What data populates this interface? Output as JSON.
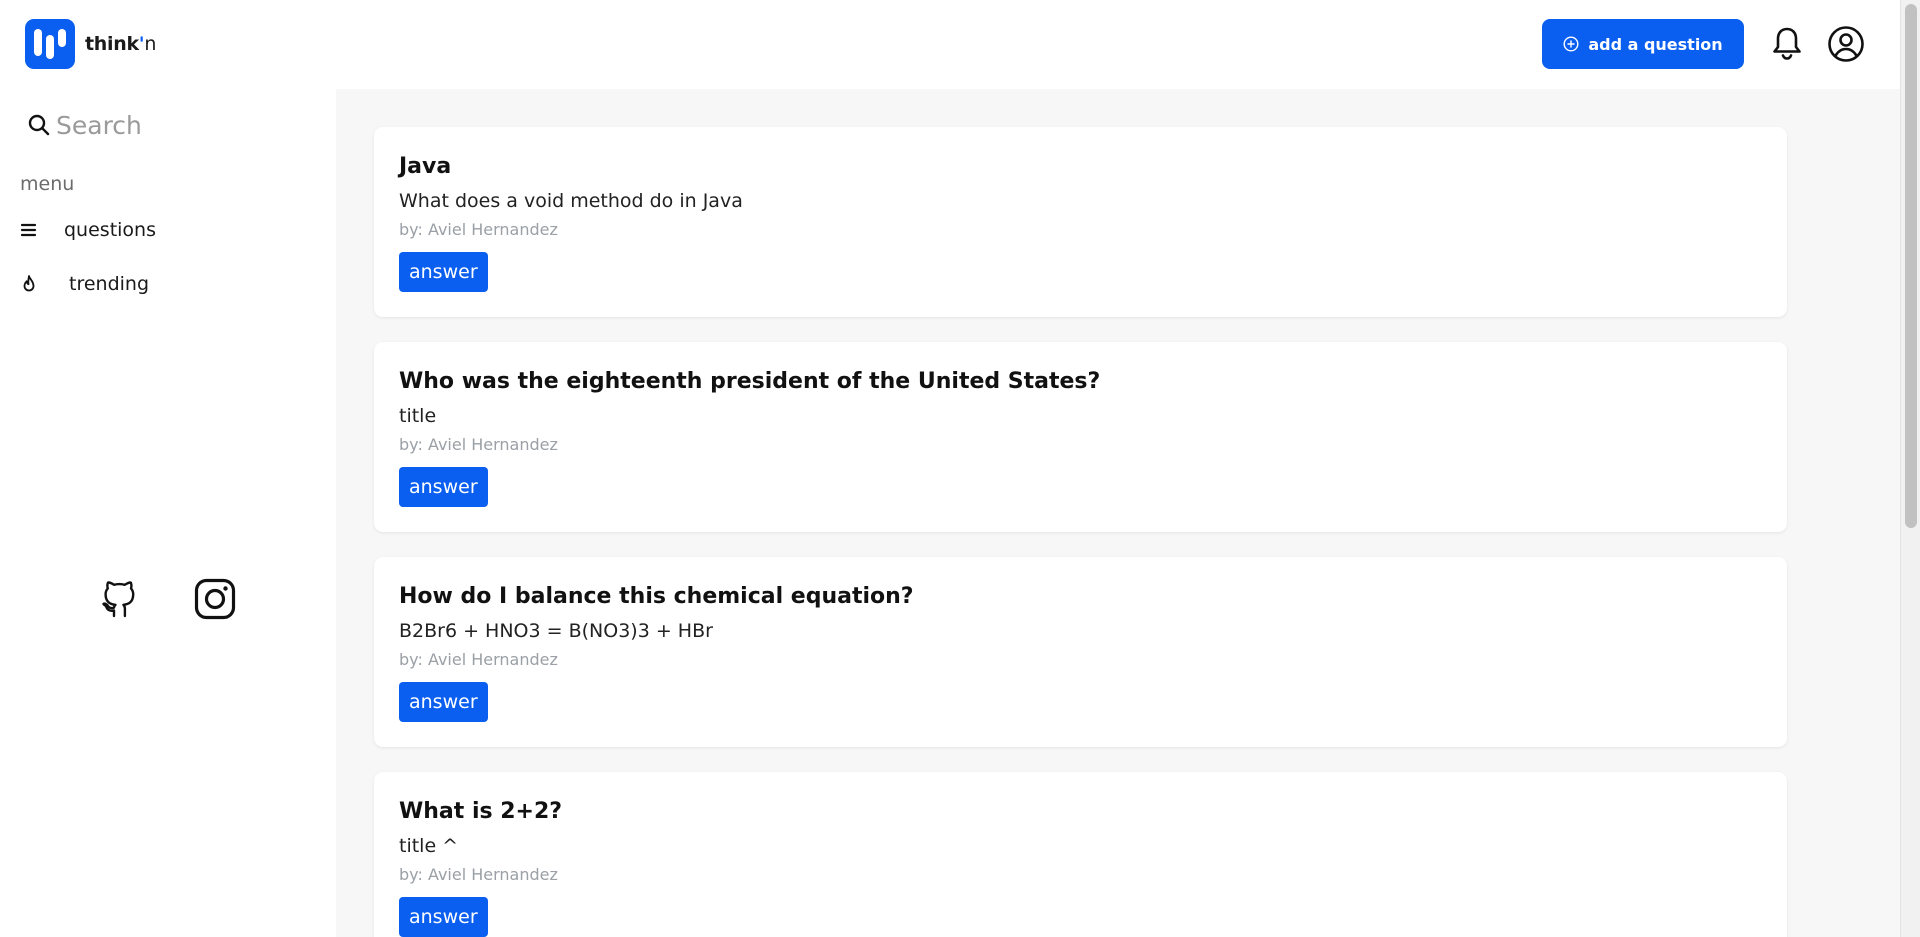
{
  "app": {
    "logo_text_think": "think",
    "logo_text_apos": "'",
    "logo_text_n": "n"
  },
  "header": {
    "add_question_label": "add a question"
  },
  "search": {
    "placeholder": "Search"
  },
  "sidebar": {
    "menu_heading": "menu",
    "items": [
      {
        "label": "questions",
        "icon": "list-icon"
      },
      {
        "label": "trending",
        "icon": "flame-icon"
      }
    ]
  },
  "questions": [
    {
      "title": "Java",
      "body": "What does a void method do in Java",
      "author": "by: Aviel Hernandez",
      "answer_label": "answer"
    },
    {
      "title": "Who was the eighteenth president of the United States?",
      "body": "title",
      "author": "by: Aviel Hernandez",
      "answer_label": "answer"
    },
    {
      "title": "How do I balance this chemical equation?",
      "body": "B2Br6 + HNO3 = B(NO3)3 + HBr",
      "author": "by: Aviel Hernandez",
      "answer_label": "answer"
    },
    {
      "title": "What is 2+2?",
      "body": "title ^",
      "author": "by: Aviel Hernandez",
      "answer_label": "answer"
    }
  ],
  "colors": {
    "accent": "#0a5ff0",
    "main_background": "#f7f7f7",
    "muted_text": "#9aa0a6"
  }
}
